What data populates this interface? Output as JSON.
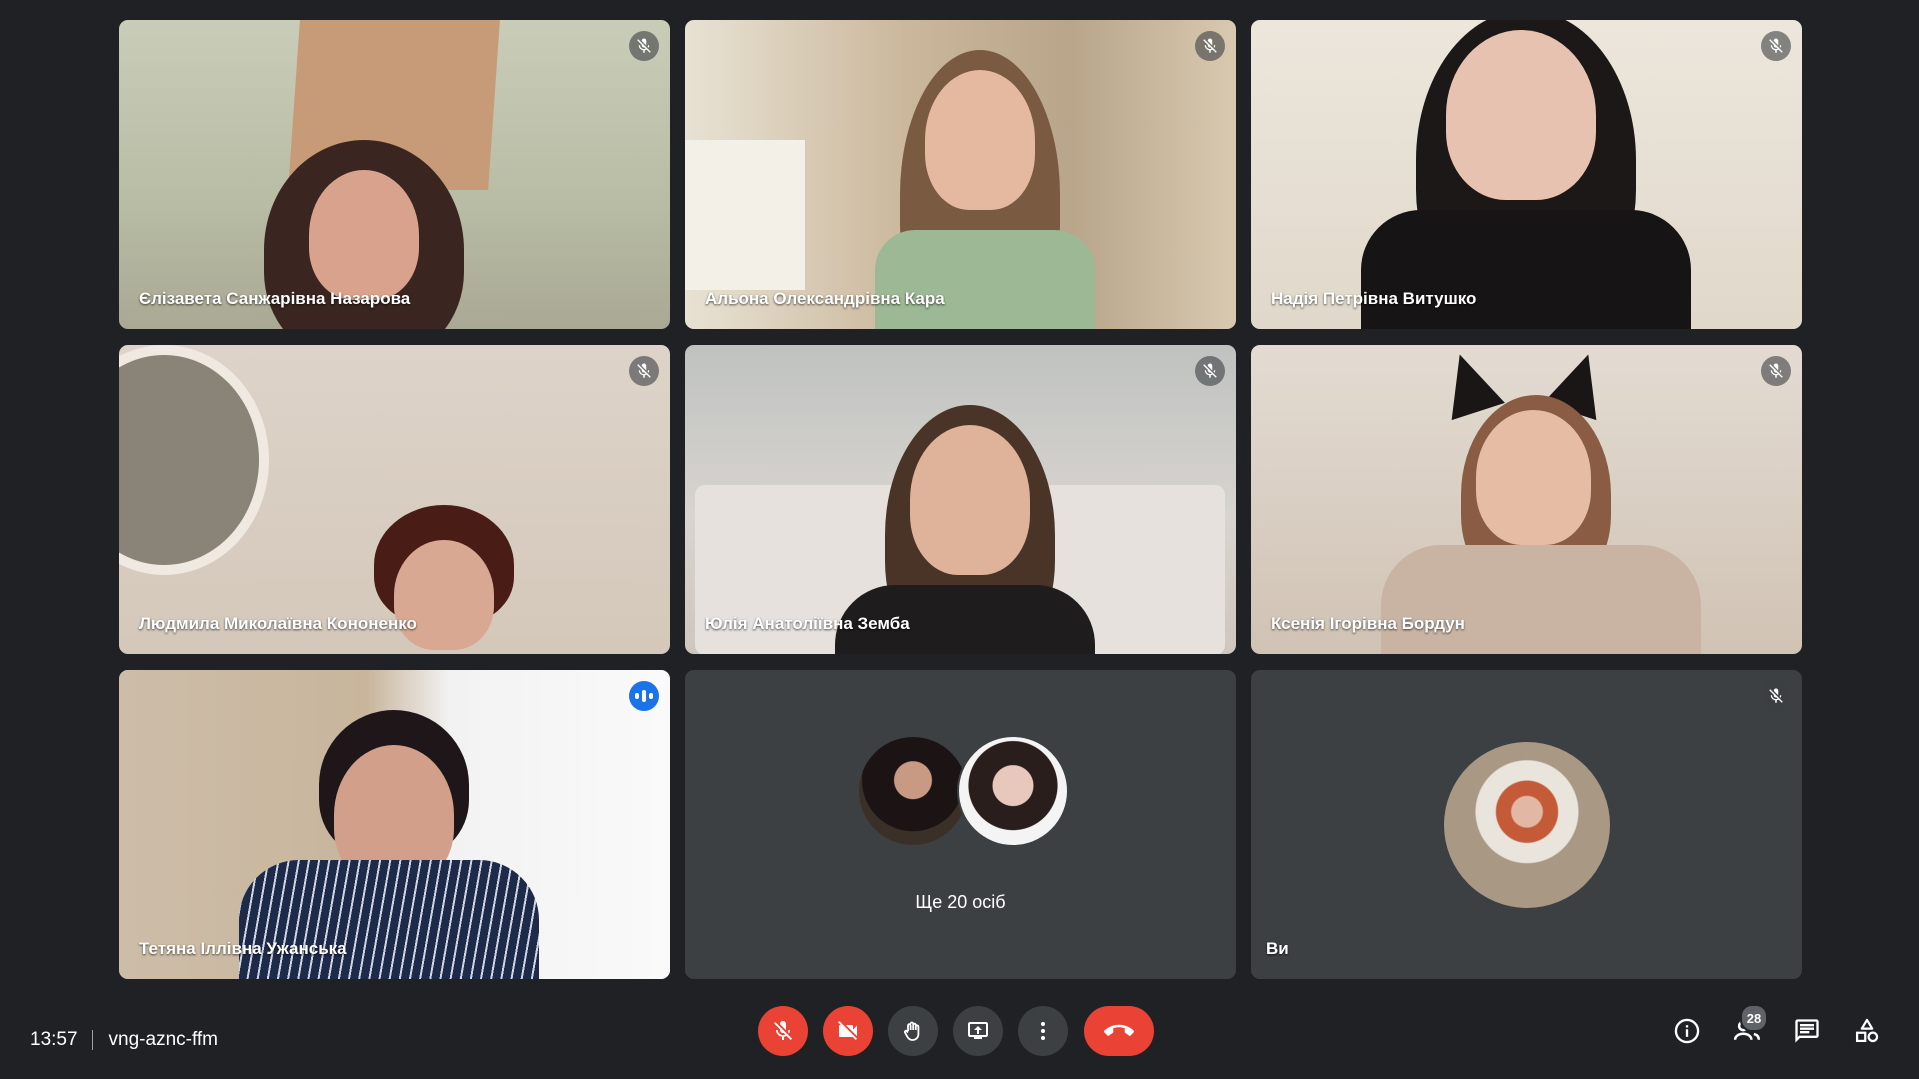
{
  "meeting": {
    "time": "13:57",
    "code": "vng-aznc-ffm"
  },
  "tiles": [
    {
      "name": "Єлізавета Санжарівна Назарова",
      "mic": "muted"
    },
    {
      "name": "Альона Олександрівна Кара",
      "mic": "muted"
    },
    {
      "name": "Надія Петрівна Витушко",
      "mic": "muted"
    },
    {
      "name": "Людмила Миколаївна Кононенко",
      "mic": "muted"
    },
    {
      "name": "Юлія Анатоліївна Земба",
      "mic": "muted"
    },
    {
      "name": "Ксенія Ігорівна Бордун",
      "mic": "muted"
    },
    {
      "name": "Тетяна Іллівна Ужанська",
      "mic": "speaking"
    }
  ],
  "overflow_tile": {
    "label": "Ще 20 осіб"
  },
  "self_tile": {
    "name": "Ви",
    "mic": "muted"
  },
  "controls": {
    "mic": "mic-off-icon",
    "camera": "camera-off-icon",
    "raise_hand": "hand-icon",
    "present": "present-screen-icon",
    "more": "more-vert-icon",
    "hangup": "hangup-icon"
  },
  "right_panel": {
    "info": "info-icon",
    "people": "people-icon",
    "people_count": "28",
    "chat": "chat-icon",
    "activities": "activities-icon"
  },
  "colors": {
    "background": "#202124",
    "tile": "#3c4043",
    "danger": "#ea4335",
    "accent": "#8ab4f8",
    "speaking": "#1a73e8"
  }
}
